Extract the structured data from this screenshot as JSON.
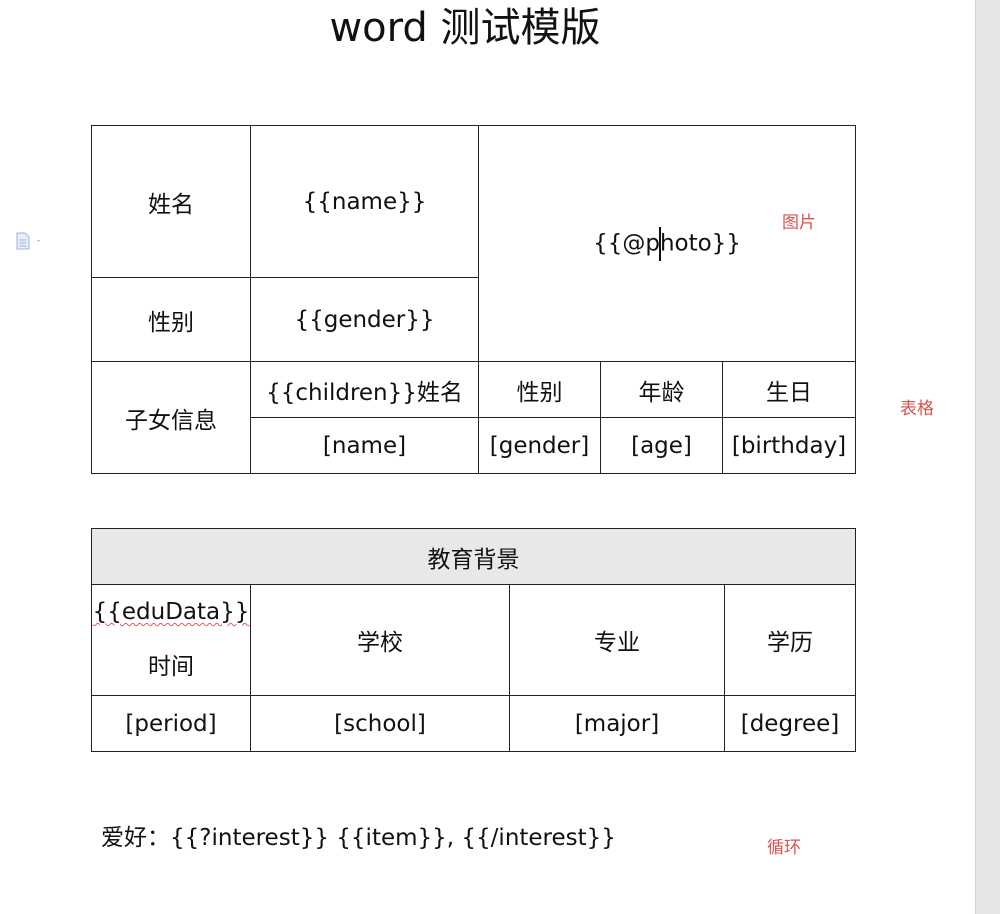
{
  "title": "word 测试模版",
  "annotations": {
    "photo": "图片",
    "table": "表格",
    "loop": "循环"
  },
  "profile_table": {
    "name_label": "姓名",
    "name_value": "{{name}}",
    "gender_label": "性别",
    "gender_value": "{{gender}}",
    "photo_before_cursor": "{{@p",
    "photo_after_cursor": "hoto}}",
    "children_label": "子女信息",
    "children_headers": [
      "{{children}}姓名",
      "性别",
      "年龄",
      "生日"
    ],
    "children_row": [
      "[name]",
      "[gender]",
      "[age]",
      "[birthday]"
    ]
  },
  "education_table": {
    "header": "教育背景",
    "edudata_tag": "{{eduData}}",
    "time_label": "时间",
    "columns": [
      "学校",
      "专业",
      "学历"
    ],
    "row": [
      "[period]",
      "[school]",
      "[major]",
      "[degree]"
    ]
  },
  "hobby_line": "爱好：{{?interest}} {{item}}, {{/interest}}",
  "colors": {
    "annotation": "#d9534f",
    "header_fill": "#e8e8e8",
    "gutter": "#e6e6e6"
  },
  "icons": [
    "document-icon"
  ]
}
